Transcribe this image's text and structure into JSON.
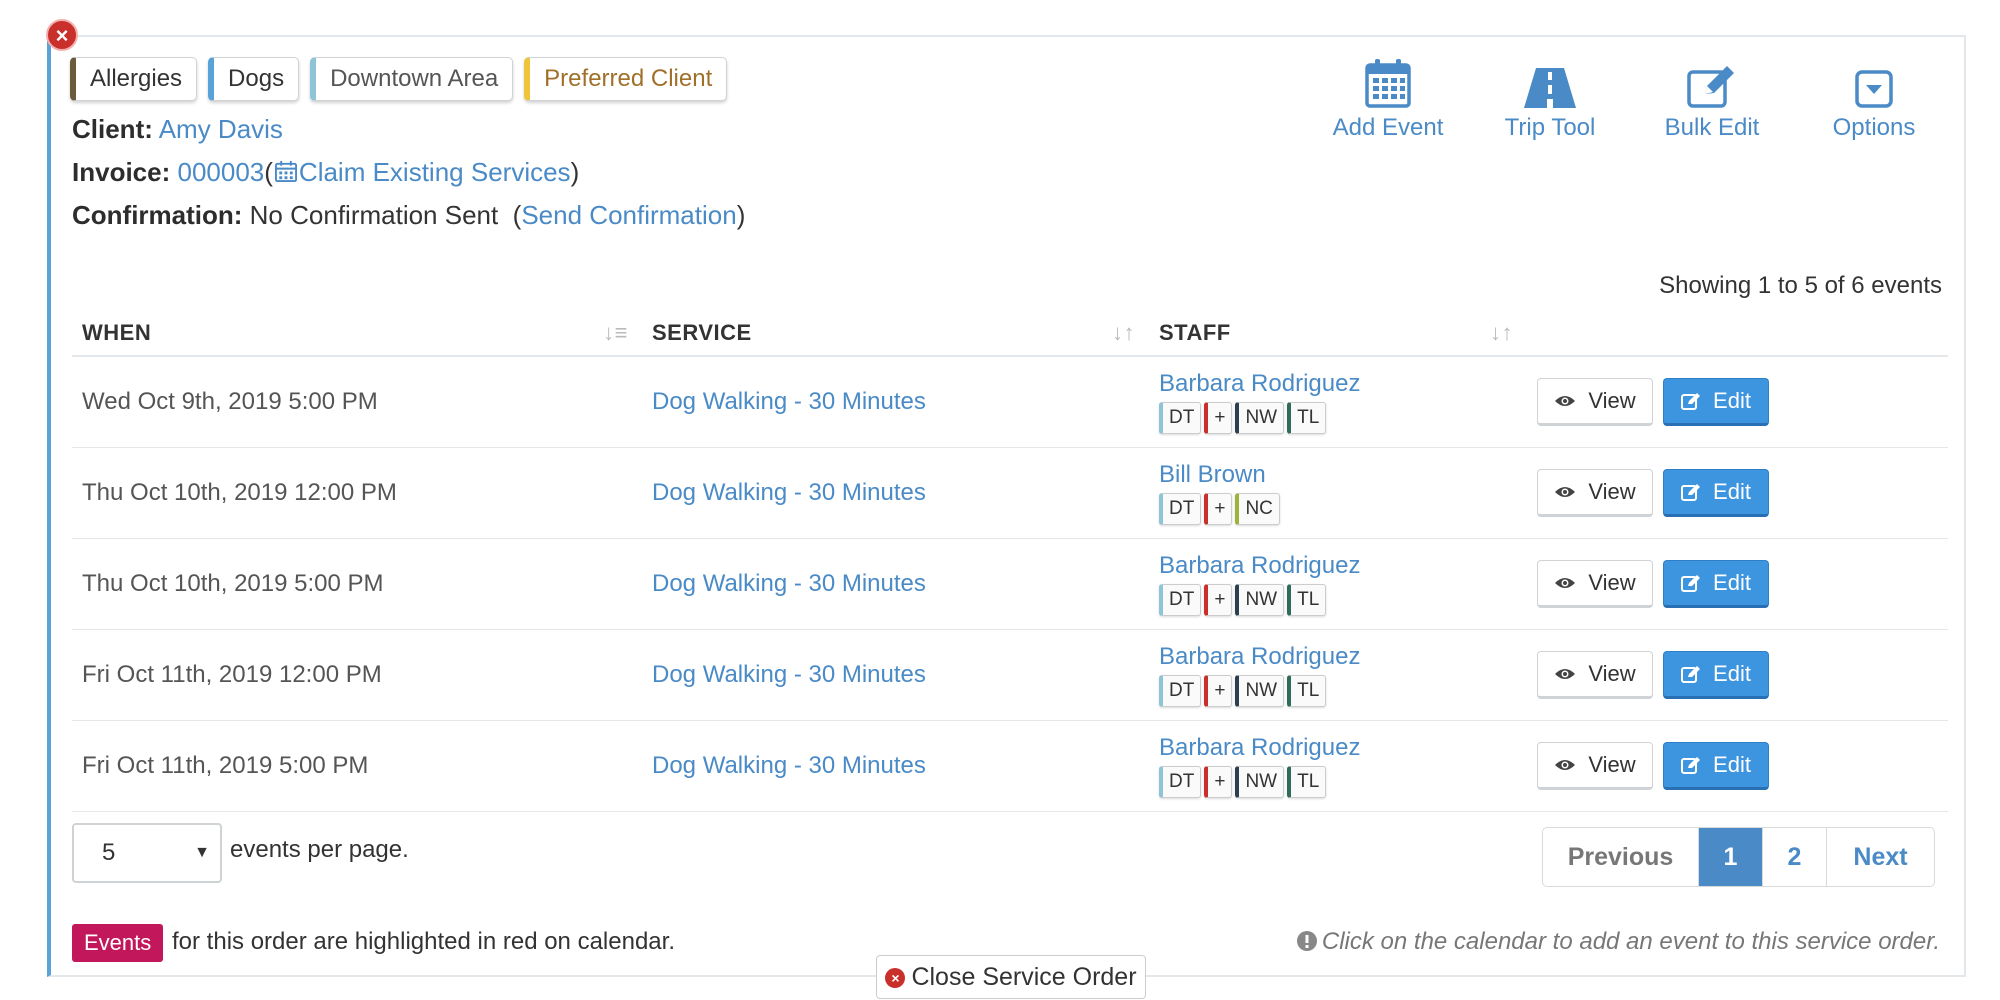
{
  "tags": [
    {
      "label": "Allergies",
      "color": "#6b5a3c",
      "text_color": "#333333"
    },
    {
      "label": "Dogs",
      "color": "#5aa3d8",
      "text_color": "#333333"
    },
    {
      "label": "Downtown Area",
      "color": "#8ec5d6",
      "text_color": "#555555"
    },
    {
      "label": "Preferred Client",
      "color": "#f0c43a",
      "text_color": "#a0702a"
    }
  ],
  "client": {
    "label": "Client:",
    "name": "Amy Davis"
  },
  "invoice": {
    "label": "Invoice:",
    "number": "000003",
    "open_paren": "(",
    "claim_link": "Claim Existing Services",
    "close_paren": ")"
  },
  "confirmation": {
    "label": "Confirmation:",
    "status": "No Confirmation Sent",
    "open_paren": "(",
    "link": "Send Confirmation",
    "close_paren": ")"
  },
  "toolbar": {
    "add_event": "Add Event",
    "trip_tool": "Trip Tool",
    "bulk_edit": "Bulk Edit",
    "options": "Options"
  },
  "showing_text": "Showing 1 to 5 of 6 events",
  "table": {
    "headers": {
      "when": "WHEN",
      "service": "SERVICE",
      "staff": "STAFF"
    },
    "rows": [
      {
        "when": "Wed Oct 9th, 2019 5:00 PM",
        "service": "Dog Walking - 30 Minutes",
        "staff": "Barbara Rodriguez",
        "badges": [
          "DT",
          "+",
          "NW",
          "TL"
        ]
      },
      {
        "when": "Thu Oct 10th, 2019 12:00 PM",
        "service": "Dog Walking - 30 Minutes",
        "staff": "Bill Brown",
        "badges": [
          "DT",
          "+",
          "NC"
        ]
      },
      {
        "when": "Thu Oct 10th, 2019 5:00 PM",
        "service": "Dog Walking - 30 Minutes",
        "staff": "Barbara Rodriguez",
        "badges": [
          "DT",
          "+",
          "NW",
          "TL"
        ]
      },
      {
        "when": "Fri Oct 11th, 2019 12:00 PM",
        "service": "Dog Walking - 30 Minutes",
        "staff": "Barbara Rodriguez",
        "badges": [
          "DT",
          "+",
          "NW",
          "TL"
        ]
      },
      {
        "when": "Fri Oct 11th, 2019 5:00 PM",
        "service": "Dog Walking - 30 Minutes",
        "staff": "Barbara Rodriguez",
        "badges": [
          "DT",
          "+",
          "NW",
          "TL"
        ]
      }
    ],
    "view_label": "View",
    "edit_label": "Edit"
  },
  "badge_colors": {
    "DT": "#8ec5d6",
    "+": "#c9302c",
    "NW": "#2c3e50",
    "TL": "#2e6b5a",
    "NC": "#9bb33a"
  },
  "per_page": {
    "value": "5",
    "label": "events per page."
  },
  "pagination": {
    "previous": "Previous",
    "pages": [
      "1",
      "2"
    ],
    "current": "1",
    "next": "Next"
  },
  "footer": {
    "events_badge": "Events",
    "events_note": "for this order are highlighted in red on calendar.",
    "hint": "Click on the calendar to add an event to this service order.",
    "close_order": "Close Service Order"
  },
  "colors": {
    "accent": "#4a8ac6",
    "edit_button": "#3d95e0",
    "events_badge": "#c2185b",
    "close_icon": "#c9302c"
  }
}
